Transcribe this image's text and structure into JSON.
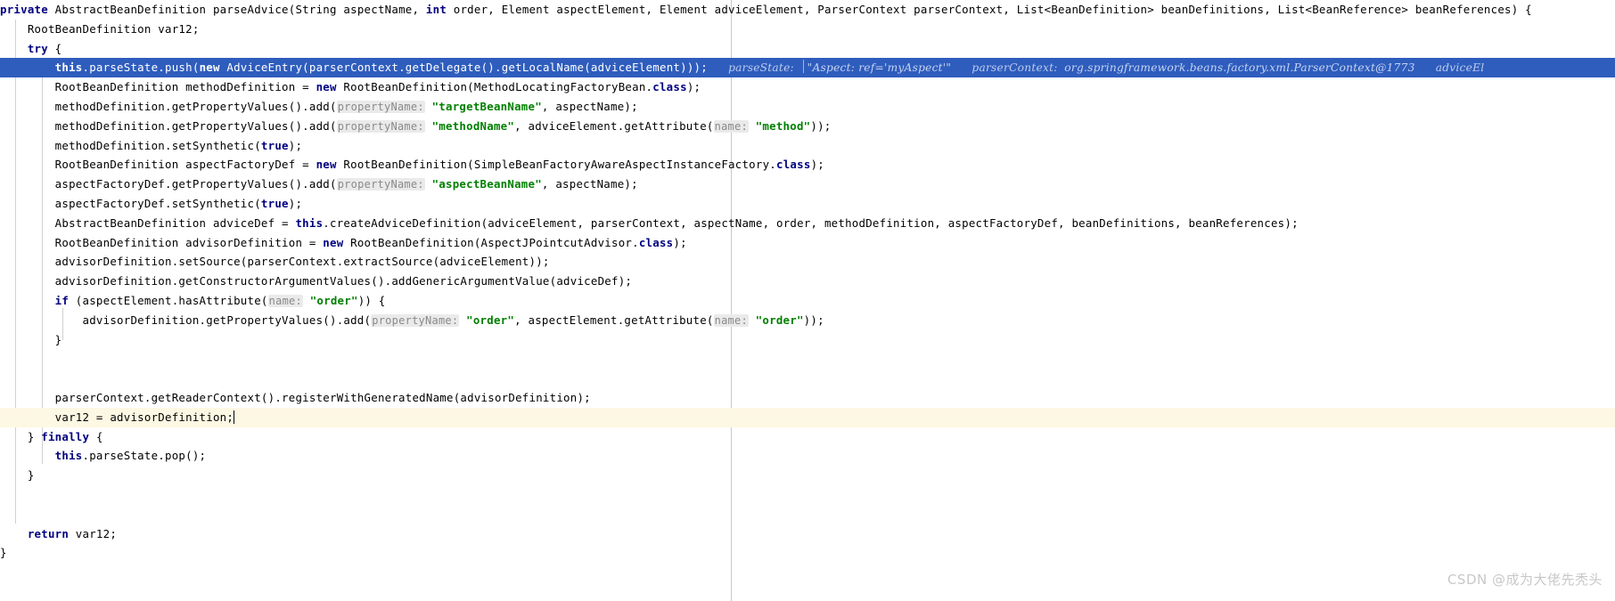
{
  "editor": {
    "language": "java",
    "method_name": "parseAdvice",
    "colors": {
      "background": "#ffffff",
      "keyword": "#000080",
      "string": "#008000",
      "execution_line_bg": "#2f5dbd",
      "caret_line_bg": "#fdf8e3",
      "param_hint_bg": "#eaeaea",
      "param_hint_text": "#8a8a8a",
      "inline_debug_text": "#c6d4f2",
      "indent_guide": "#d0d0d0",
      "watermark": "#c8c8c8"
    }
  },
  "debugger": {
    "execution_line_index": 2,
    "inline_values": [
      {
        "name": "parseState:",
        "value": "\"Aspect: ref='myAspect'\""
      },
      {
        "name": "parserContext:",
        "value": "org.springframework.beans.factory.xml.ParserContext@1773"
      },
      {
        "name": "adviceEl",
        "value": ""
      }
    ]
  },
  "watermark": {
    "text": "CSDN @成为大佬先秃头"
  },
  "code": {
    "lines": [
      {
        "id": "signature",
        "indent": 0,
        "segments": [
          {
            "t": "kw",
            "v": "private"
          },
          {
            "t": "plain",
            "v": " AbstractBeanDefinition parseAdvice(String aspectName, "
          },
          {
            "t": "kw",
            "v": "int"
          },
          {
            "t": "plain",
            "v": " order, Element aspectElement, Element adviceElement, ParserContext parserContext, List<BeanDefinition> beanDefinitions, List<BeanReference> beanReferences) {"
          }
        ]
      },
      {
        "id": "declare-var12",
        "indent": 1,
        "segments": [
          {
            "t": "plain",
            "v": "RootBeanDefinition var12;"
          }
        ]
      },
      {
        "id": "try-open",
        "indent": 1,
        "segments": [
          {
            "t": "kw",
            "v": "try"
          },
          {
            "t": "plain",
            "v": " {"
          }
        ]
      },
      {
        "id": "push-advice-entry",
        "indent": 2,
        "exec": true,
        "segments": [
          {
            "t": "kw",
            "v": "this"
          },
          {
            "t": "plain",
            "v": ".parseState.push("
          },
          {
            "t": "kw",
            "v": "new"
          },
          {
            "t": "plain",
            "v": " AdviceEntry(parserContext.getDelegate().getLocalName(adviceElement)));"
          }
        ],
        "inline": [
          {
            "kind": "sep"
          },
          {
            "kind": "name",
            "v": "parseState:"
          },
          {
            "kind": "bar"
          },
          {
            "kind": "val",
            "v": "\"Aspect: ref='myAspect'\""
          },
          {
            "kind": "gap"
          },
          {
            "kind": "name",
            "v": "parserContext:"
          },
          {
            "kind": "val",
            "v": "org.springframework.beans.factory.xml.ParserContext@1773"
          },
          {
            "kind": "gap"
          },
          {
            "kind": "name",
            "v": "adviceEl"
          }
        ]
      },
      {
        "id": "method-definition-new",
        "indent": 2,
        "segments": [
          {
            "t": "plain",
            "v": "RootBeanDefinition methodDefinition = "
          },
          {
            "t": "kw",
            "v": "new"
          },
          {
            "t": "plain",
            "v": " RootBeanDefinition(MethodLocatingFactoryBean."
          },
          {
            "t": "kw",
            "v": "class"
          },
          {
            "t": "plain",
            "v": ");"
          }
        ]
      },
      {
        "id": "add-targetBeanName",
        "indent": 2,
        "segments": [
          {
            "t": "plain",
            "v": "methodDefinition.getPropertyValues().add("
          },
          {
            "t": "hint",
            "v": "propertyName:"
          },
          {
            "t": "plain",
            "v": " "
          },
          {
            "t": "str",
            "v": "\"targetBeanName\""
          },
          {
            "t": "plain",
            "v": ", aspectName);"
          }
        ]
      },
      {
        "id": "add-methodName",
        "indent": 2,
        "segments": [
          {
            "t": "plain",
            "v": "methodDefinition.getPropertyValues().add("
          },
          {
            "t": "hint",
            "v": "propertyName:"
          },
          {
            "t": "plain",
            "v": " "
          },
          {
            "t": "str",
            "v": "\"methodName\""
          },
          {
            "t": "plain",
            "v": ", adviceElement.getAttribute("
          },
          {
            "t": "hint",
            "v": "name:"
          },
          {
            "t": "plain",
            "v": " "
          },
          {
            "t": "str",
            "v": "\"method\""
          },
          {
            "t": "plain",
            "v": "));"
          }
        ]
      },
      {
        "id": "method-setSynthetic",
        "indent": 2,
        "segments": [
          {
            "t": "plain",
            "v": "methodDefinition.setSynthetic("
          },
          {
            "t": "kw",
            "v": "true"
          },
          {
            "t": "plain",
            "v": ");"
          }
        ]
      },
      {
        "id": "aspect-factory-def-new",
        "indent": 2,
        "segments": [
          {
            "t": "plain",
            "v": "RootBeanDefinition aspectFactoryDef = "
          },
          {
            "t": "kw",
            "v": "new"
          },
          {
            "t": "plain",
            "v": " RootBeanDefinition(SimpleBeanFactoryAwareAspectInstanceFactory."
          },
          {
            "t": "kw",
            "v": "class"
          },
          {
            "t": "plain",
            "v": ");"
          }
        ]
      },
      {
        "id": "add-aspectBeanName",
        "indent": 2,
        "segments": [
          {
            "t": "plain",
            "v": "aspectFactoryDef.getPropertyValues().add("
          },
          {
            "t": "hint",
            "v": "propertyName:"
          },
          {
            "t": "plain",
            "v": " "
          },
          {
            "t": "str",
            "v": "\"aspectBeanName\""
          },
          {
            "t": "plain",
            "v": ", aspectName);"
          }
        ]
      },
      {
        "id": "aspect-factory-setSynthetic",
        "indent": 2,
        "segments": [
          {
            "t": "plain",
            "v": "aspectFactoryDef.setSynthetic("
          },
          {
            "t": "kw",
            "v": "true"
          },
          {
            "t": "plain",
            "v": ");"
          }
        ]
      },
      {
        "id": "create-advice-definition",
        "indent": 2,
        "segments": [
          {
            "t": "plain",
            "v": "AbstractBeanDefinition adviceDef = "
          },
          {
            "t": "kw",
            "v": "this"
          },
          {
            "t": "plain",
            "v": ".createAdviceDefinition(adviceElement, parserContext, aspectName, order, methodDefinition, aspectFactoryDef, beanDefinitions, beanReferences);"
          }
        ]
      },
      {
        "id": "advisor-definition-new",
        "indent": 2,
        "segments": [
          {
            "t": "plain",
            "v": "RootBeanDefinition advisorDefinition = "
          },
          {
            "t": "kw",
            "v": "new"
          },
          {
            "t": "plain",
            "v": " RootBeanDefinition(AspectJPointcutAdvisor."
          },
          {
            "t": "kw",
            "v": "class"
          },
          {
            "t": "plain",
            "v": ");"
          }
        ]
      },
      {
        "id": "advisor-setSource",
        "indent": 2,
        "segments": [
          {
            "t": "plain",
            "v": "advisorDefinition.setSource(parserContext.extractSource(adviceElement));"
          }
        ]
      },
      {
        "id": "advisor-add-ctor-arg",
        "indent": 2,
        "segments": [
          {
            "t": "plain",
            "v": "advisorDefinition.getConstructorArgumentValues().addGenericArgumentValue(adviceDef);"
          }
        ]
      },
      {
        "id": "if-has-order",
        "indent": 2,
        "segments": [
          {
            "t": "kw",
            "v": "if"
          },
          {
            "t": "plain",
            "v": " (aspectElement.hasAttribute("
          },
          {
            "t": "hint",
            "v": "name:"
          },
          {
            "t": "plain",
            "v": " "
          },
          {
            "t": "str",
            "v": "\"order\""
          },
          {
            "t": "plain",
            "v": ")) {"
          }
        ]
      },
      {
        "id": "add-order-property",
        "indent": 3,
        "segments": [
          {
            "t": "plain",
            "v": "advisorDefinition.getPropertyValues().add("
          },
          {
            "t": "hint",
            "v": "propertyName:"
          },
          {
            "t": "plain",
            "v": " "
          },
          {
            "t": "str",
            "v": "\"order\""
          },
          {
            "t": "plain",
            "v": ", aspectElement.getAttribute("
          },
          {
            "t": "hint",
            "v": "name:"
          },
          {
            "t": "plain",
            "v": " "
          },
          {
            "t": "str",
            "v": "\"order\""
          },
          {
            "t": "plain",
            "v": "));"
          }
        ]
      },
      {
        "id": "if-close",
        "indent": 2,
        "segments": [
          {
            "t": "plain",
            "v": "}"
          }
        ]
      },
      {
        "id": "blank-1",
        "indent": 0,
        "segments": [
          {
            "t": "plain",
            "v": ""
          }
        ]
      },
      {
        "id": "blank-2",
        "indent": 0,
        "segments": [
          {
            "t": "plain",
            "v": ""
          }
        ]
      },
      {
        "id": "register-with-generated-name",
        "indent": 2,
        "segments": [
          {
            "t": "plain",
            "v": "parserContext.getReaderContext().registerWithGeneratedName(advisorDefinition);"
          }
        ]
      },
      {
        "id": "assign-var12",
        "indent": 2,
        "caretline": true,
        "caret": true,
        "segments": [
          {
            "t": "plain",
            "v": "var12 = advisorDefinition;"
          }
        ]
      },
      {
        "id": "finally-open",
        "indent": 1,
        "segments": [
          {
            "t": "plain",
            "v": "} "
          },
          {
            "t": "kw",
            "v": "finally"
          },
          {
            "t": "plain",
            "v": " {"
          }
        ]
      },
      {
        "id": "parse-state-pop",
        "indent": 2,
        "segments": [
          {
            "t": "kw",
            "v": "this"
          },
          {
            "t": "plain",
            "v": ".parseState.pop();"
          }
        ]
      },
      {
        "id": "finally-close",
        "indent": 1,
        "segments": [
          {
            "t": "plain",
            "v": "}"
          }
        ]
      },
      {
        "id": "blank-3",
        "indent": 0,
        "segments": [
          {
            "t": "plain",
            "v": ""
          }
        ]
      },
      {
        "id": "blank-4",
        "indent": 0,
        "segments": [
          {
            "t": "plain",
            "v": ""
          }
        ]
      },
      {
        "id": "return-var12",
        "indent": 1,
        "segments": [
          {
            "t": "kw",
            "v": "return"
          },
          {
            "t": "plain",
            "v": " var12;"
          }
        ]
      },
      {
        "id": "method-close",
        "indent": 0,
        "segments": [
          {
            "t": "plain",
            "v": "}"
          }
        ]
      }
    ]
  }
}
